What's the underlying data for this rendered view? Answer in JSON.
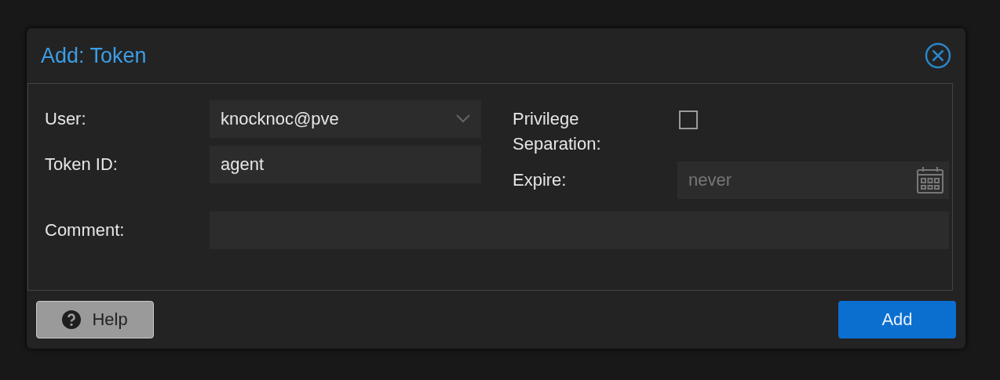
{
  "dialog": {
    "title": "Add: Token"
  },
  "left_fields": [
    {
      "kind": "combo",
      "label": "User:",
      "value": "knocknoc@pve"
    },
    {
      "kind": "text",
      "label": "Token ID:",
      "value": "agent"
    }
  ],
  "right_fields": [
    {
      "kind": "checkbox",
      "label": "Privilege Separation:",
      "checked": false
    },
    {
      "kind": "date",
      "label": "Expire:",
      "placeholder": "never"
    }
  ],
  "bottom_fields": [
    {
      "kind": "text",
      "label": "Comment:"
    }
  ],
  "buttons": [
    {
      "kind": "help",
      "label": "Help"
    },
    {
      "kind": "primary",
      "label": "Add"
    }
  ]
}
